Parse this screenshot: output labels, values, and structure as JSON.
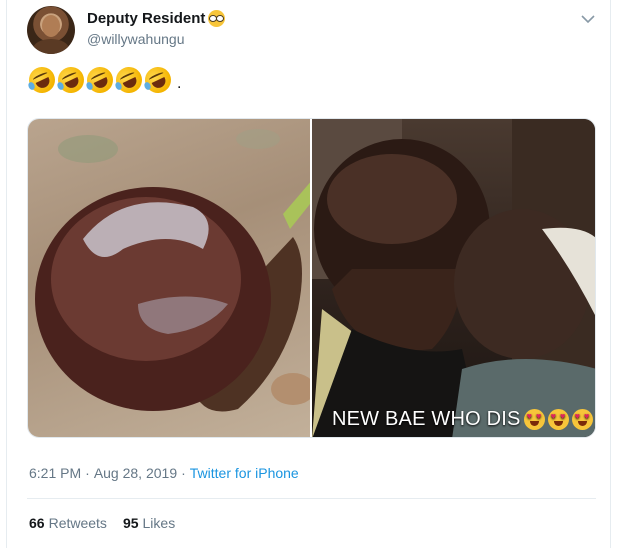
{
  "user": {
    "display_name": "Deputy Resident",
    "handle": "@willywahungu",
    "name_emoji": "nerd-face-icon"
  },
  "tweet": {
    "emoji_icon": "rolling-on-floor-laughing-icon",
    "emoji_count": 5,
    "trailing_text": ".",
    "meme_caption": "NEW BAE WHO DIS",
    "caption_emoji_icon": "heart-eyes-icon",
    "caption_emoji_count": 3
  },
  "meta": {
    "time": "6:21 PM",
    "separator": "·",
    "date": "Aug 28, 2019",
    "source": "Twitter for iPhone"
  },
  "stats": {
    "retweets_count": "66",
    "retweets_label": "Retweets",
    "likes_count": "95",
    "likes_label": "Likes"
  },
  "colors": {
    "link_blue": "#1b95e0",
    "secondary_gray": "#657786",
    "border": "#e6ecf0"
  }
}
